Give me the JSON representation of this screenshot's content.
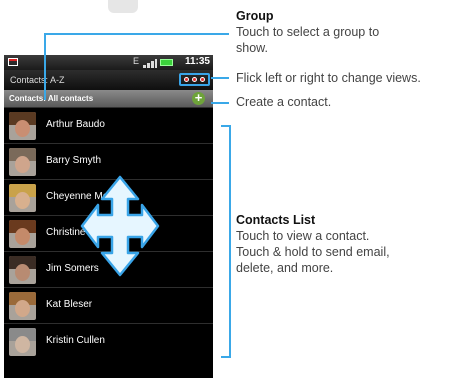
{
  "status_bar": {
    "network": "E",
    "time": "11:35"
  },
  "title_bar": {
    "title": "Contacts: A-Z"
  },
  "group_bar": {
    "label": "Contacts: All contacts",
    "add_symbol": "+"
  },
  "contacts": [
    {
      "name": "Arthur Baudo",
      "hair": "#5a3a22",
      "skin": "#c98e72"
    },
    {
      "name": "Barry Smyth",
      "hair": "#7a6a5a",
      "skin": "#cfa58c"
    },
    {
      "name": "Cheyenne Medina",
      "hair": "#c9a24a",
      "skin": "#d8b08e"
    },
    {
      "name": "Christine Fanning",
      "hair": "#6a3a1e",
      "skin": "#c48a6a"
    },
    {
      "name": "Jim Somers",
      "hair": "#3a2c24",
      "skin": "#b88b72"
    },
    {
      "name": "Kat Bleser",
      "hair": "#9a6a3a",
      "skin": "#d2a88a"
    },
    {
      "name": "Kristin Cullen",
      "hair": "#8a8a8a",
      "skin": "#cfb6a2"
    }
  ],
  "annotations": {
    "group_title": "Group",
    "group_text_1": "Touch to select a group to",
    "group_text_2": "show.",
    "flick_text": "Flick left or right to change views.",
    "create_text": "Create a contact.",
    "list_title": "Contacts  List",
    "list_text_1": "Touch to view a contact.",
    "list_text_2": "Touch & hold to send email,",
    "list_text_3": "delete, and more."
  },
  "colors": {
    "callout_line": "#3aa8e8",
    "dpad_fill": "#e6f6ff",
    "dpad_stroke": "#39a4e8"
  },
  "icons": [
    "notification-icon",
    "signal-icon",
    "battery-icon",
    "view-indicator-icon",
    "add-contact-icon",
    "navigation-dpad-icon"
  ]
}
